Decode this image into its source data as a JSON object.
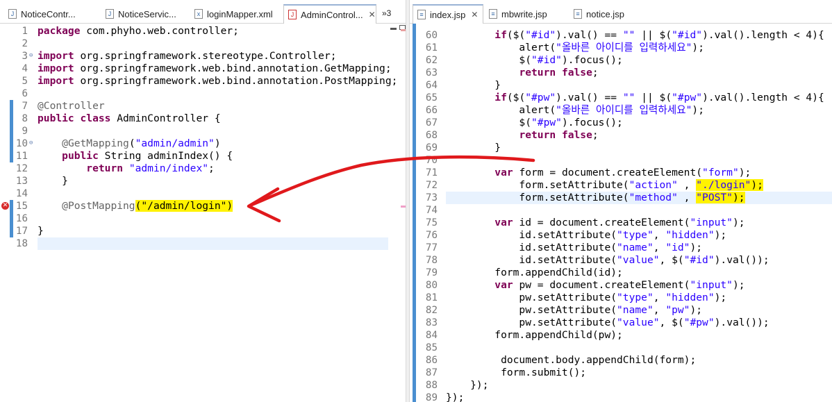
{
  "left_editor": {
    "tabs": [
      {
        "label": "NoticeContr...",
        "icon": "java-file-icon"
      },
      {
        "label": "NoticeServic...",
        "icon": "java-file-icon"
      },
      {
        "label": "loginMapper.xml",
        "icon": "xml-file-icon"
      },
      {
        "label": "AdminControl...",
        "icon": "java-error-file-icon",
        "close": "✕",
        "active": true
      }
    ],
    "overflow_label": "»3",
    "line_numbers": [
      "1",
      "2",
      "3",
      "4",
      "5",
      "6",
      "7",
      "8",
      "9",
      "10",
      "11",
      "12",
      "13",
      "14",
      "15",
      "16",
      "17",
      "18"
    ],
    "lines": [
      [
        {
          "t": "package",
          "c": "kw"
        },
        {
          "t": " com.phyho.web.controller;"
        }
      ],
      [],
      [
        {
          "t": "import",
          "c": "kw"
        },
        {
          "t": " org.springframework.stereotype.Controller;"
        }
      ],
      [
        {
          "t": "import",
          "c": "kw"
        },
        {
          "t": " org.springframework.web.bind.annotation.GetMapping;"
        }
      ],
      [
        {
          "t": "import",
          "c": "kw"
        },
        {
          "t": " org.springframework.web.bind.annotation.PostMapping;"
        }
      ],
      [],
      [
        {
          "t": "@Controller",
          "c": "ann"
        }
      ],
      [
        {
          "t": "public",
          "c": "kw"
        },
        {
          "t": " "
        },
        {
          "t": "class",
          "c": "kw"
        },
        {
          "t": " AdminController {"
        }
      ],
      [],
      [
        {
          "t": "    "
        },
        {
          "t": "@GetMapping",
          "c": "ann"
        },
        {
          "t": "("
        },
        {
          "t": "\"admin/admin\"",
          "c": "str"
        },
        {
          "t": ")"
        }
      ],
      [
        {
          "t": "    "
        },
        {
          "t": "public",
          "c": "kw"
        },
        {
          "t": " String adminIndex() {"
        }
      ],
      [
        {
          "t": "        "
        },
        {
          "t": "return",
          "c": "kw"
        },
        {
          "t": " "
        },
        {
          "t": "\"admin/index\"",
          "c": "str"
        },
        {
          "t": ";"
        }
      ],
      [
        {
          "t": "    }"
        }
      ],
      [],
      [
        {
          "t": "    "
        },
        {
          "t": "@PostMapping",
          "c": "ann"
        },
        {
          "t": "(\"/admin/login\")",
          "c": "hl"
        }
      ],
      [],
      [
        {
          "t": "}"
        }
      ],
      []
    ]
  },
  "right_editor": {
    "tabs": [
      {
        "label": "index.jsp",
        "icon": "jsp-file-icon",
        "close": "✕",
        "active": true
      },
      {
        "label": "mbwrite.jsp",
        "icon": "jsp-file-icon"
      },
      {
        "label": "notice.jsp",
        "icon": "jsp-file-icon"
      }
    ],
    "line_numbers": [
      "60",
      "61",
      "62",
      "63",
      "64",
      "65",
      "66",
      "67",
      "68",
      "69",
      "70",
      "71",
      "72",
      "73",
      "74",
      "75",
      "76",
      "77",
      "78",
      "79",
      "80",
      "81",
      "82",
      "83",
      "84",
      "85",
      "86",
      "87",
      "88",
      "89"
    ],
    "lines": [
      [
        {
          "t": "        "
        },
        {
          "t": "if",
          "c": "kw"
        },
        {
          "t": "($("
        },
        {
          "t": "\"#id\"",
          "c": "str"
        },
        {
          "t": ").val() == "
        },
        {
          "t": "\"\"",
          "c": "str"
        },
        {
          "t": " || $("
        },
        {
          "t": "\"#id\"",
          "c": "str"
        },
        {
          "t": ").val().length < 4){"
        }
      ],
      [
        {
          "t": "            alert("
        },
        {
          "t": "\"올바른 아이디를 입력하세요\"",
          "c": "str"
        },
        {
          "t": ");"
        }
      ],
      [
        {
          "t": "            $("
        },
        {
          "t": "\"#id\"",
          "c": "str"
        },
        {
          "t": ").focus();"
        }
      ],
      [
        {
          "t": "            "
        },
        {
          "t": "return",
          "c": "kw"
        },
        {
          "t": " "
        },
        {
          "t": "false",
          "c": "kw"
        },
        {
          "t": ";"
        }
      ],
      [
        {
          "t": "        }"
        }
      ],
      [
        {
          "t": "        "
        },
        {
          "t": "if",
          "c": "kw"
        },
        {
          "t": "($("
        },
        {
          "t": "\"#pw\"",
          "c": "str"
        },
        {
          "t": ").val() == "
        },
        {
          "t": "\"\"",
          "c": "str"
        },
        {
          "t": " || $("
        },
        {
          "t": "\"#pw\"",
          "c": "str"
        },
        {
          "t": ").val().length < 4){"
        }
      ],
      [
        {
          "t": "            alert("
        },
        {
          "t": "\"올바른 아이디를 입력하세요\"",
          "c": "str"
        },
        {
          "t": ");"
        }
      ],
      [
        {
          "t": "            $("
        },
        {
          "t": "\"#pw\"",
          "c": "str"
        },
        {
          "t": ").focus();"
        }
      ],
      [
        {
          "t": "            "
        },
        {
          "t": "return",
          "c": "kw"
        },
        {
          "t": " "
        },
        {
          "t": "false",
          "c": "kw"
        },
        {
          "t": ";"
        }
      ],
      [
        {
          "t": "        }"
        }
      ],
      [],
      [
        {
          "t": "        "
        },
        {
          "t": "var",
          "c": "kw"
        },
        {
          "t": " form = document.createElement("
        },
        {
          "t": "\"form\"",
          "c": "str"
        },
        {
          "t": ");"
        }
      ],
      [
        {
          "t": "            form.setAttribute("
        },
        {
          "t": "\"action\"",
          "c": "str"
        },
        {
          "t": " , "
        },
        {
          "t": "\"./login\"",
          "c": "str hl"
        },
        {
          "t": ");",
          "c": "hl"
        }
      ],
      [
        {
          "t": "            form.setAttribute("
        },
        {
          "t": "\"method\"",
          "c": "str"
        },
        {
          "t": " , "
        },
        {
          "t": "\"POST\"",
          "c": "str hl"
        },
        {
          "t": ");",
          "c": "hl"
        }
      ],
      [],
      [
        {
          "t": "        "
        },
        {
          "t": "var",
          "c": "kw"
        },
        {
          "t": " id = document.createElement("
        },
        {
          "t": "\"input\"",
          "c": "str"
        },
        {
          "t": ");"
        }
      ],
      [
        {
          "t": "            id.setAttribute("
        },
        {
          "t": "\"type\"",
          "c": "str"
        },
        {
          "t": ", "
        },
        {
          "t": "\"hidden\"",
          "c": "str"
        },
        {
          "t": ");"
        }
      ],
      [
        {
          "t": "            id.setAttribute("
        },
        {
          "t": "\"name\"",
          "c": "str"
        },
        {
          "t": ", "
        },
        {
          "t": "\"id\"",
          "c": "str"
        },
        {
          "t": ");"
        }
      ],
      [
        {
          "t": "            id.setAttribute("
        },
        {
          "t": "\"value\"",
          "c": "str"
        },
        {
          "t": ", $("
        },
        {
          "t": "\"#id\"",
          "c": "str"
        },
        {
          "t": ").val());"
        }
      ],
      [
        {
          "t": "        form.appendChild(id);"
        }
      ],
      [
        {
          "t": "        "
        },
        {
          "t": "var",
          "c": "kw"
        },
        {
          "t": " pw = document.createElement("
        },
        {
          "t": "\"input\"",
          "c": "str"
        },
        {
          "t": ");"
        }
      ],
      [
        {
          "t": "            pw.setAttribute("
        },
        {
          "t": "\"type\"",
          "c": "str"
        },
        {
          "t": ", "
        },
        {
          "t": "\"hidden\"",
          "c": "str"
        },
        {
          "t": ");"
        }
      ],
      [
        {
          "t": "            pw.setAttribute("
        },
        {
          "t": "\"name\"",
          "c": "str"
        },
        {
          "t": ", "
        },
        {
          "t": "\"pw\"",
          "c": "str"
        },
        {
          "t": ");"
        }
      ],
      [
        {
          "t": "            pw.setAttribute("
        },
        {
          "t": "\"value\"",
          "c": "str"
        },
        {
          "t": ", $("
        },
        {
          "t": "\"#pw\"",
          "c": "str"
        },
        {
          "t": ").val());"
        }
      ],
      [
        {
          "t": "        form.appendChild(pw);"
        }
      ],
      [],
      [
        {
          "t": "         document.body.appendChild(form);"
        }
      ],
      [
        {
          "t": "         form.submit();"
        }
      ],
      [
        {
          "t": "    });"
        }
      ],
      [
        {
          "t": "});"
        }
      ]
    ]
  },
  "colors": {
    "keyword": "#7f0055",
    "string": "#2a00ff",
    "annotation": "#646464",
    "highlight": "#fff200",
    "arrow": "#e0191c",
    "current_line": "#e8f2fe",
    "ruler_marker": "#4a8fd0"
  }
}
